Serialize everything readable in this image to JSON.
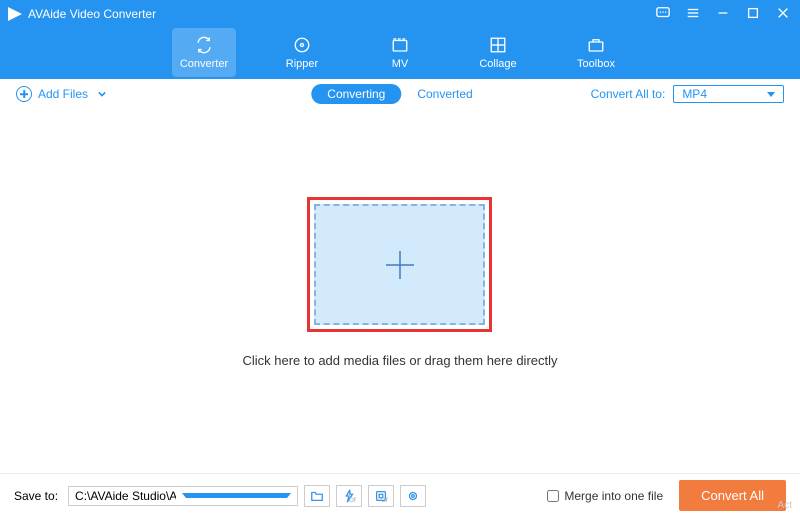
{
  "app": {
    "title": "AVAide Video Converter"
  },
  "nav": {
    "converter": "Converter",
    "ripper": "Ripper",
    "mv": "MV",
    "collage": "Collage",
    "toolbox": "Toolbox"
  },
  "toolbar": {
    "add_files": "Add Files",
    "seg_converting": "Converting",
    "seg_converted": "Converted",
    "convert_all_to": "Convert All to:",
    "format": "MP4"
  },
  "main": {
    "instruction": "Click here to add media files or drag them here directly"
  },
  "footer": {
    "save_to": "Save to:",
    "path": "C:\\AVAide Studio\\AVAid...eo Converter\\Converted",
    "merge": "Merge into one file",
    "convert_all": "Convert All"
  },
  "colors": {
    "primary": "#2593f0",
    "accent": "#f27b3e",
    "highlight": "#e73434"
  }
}
